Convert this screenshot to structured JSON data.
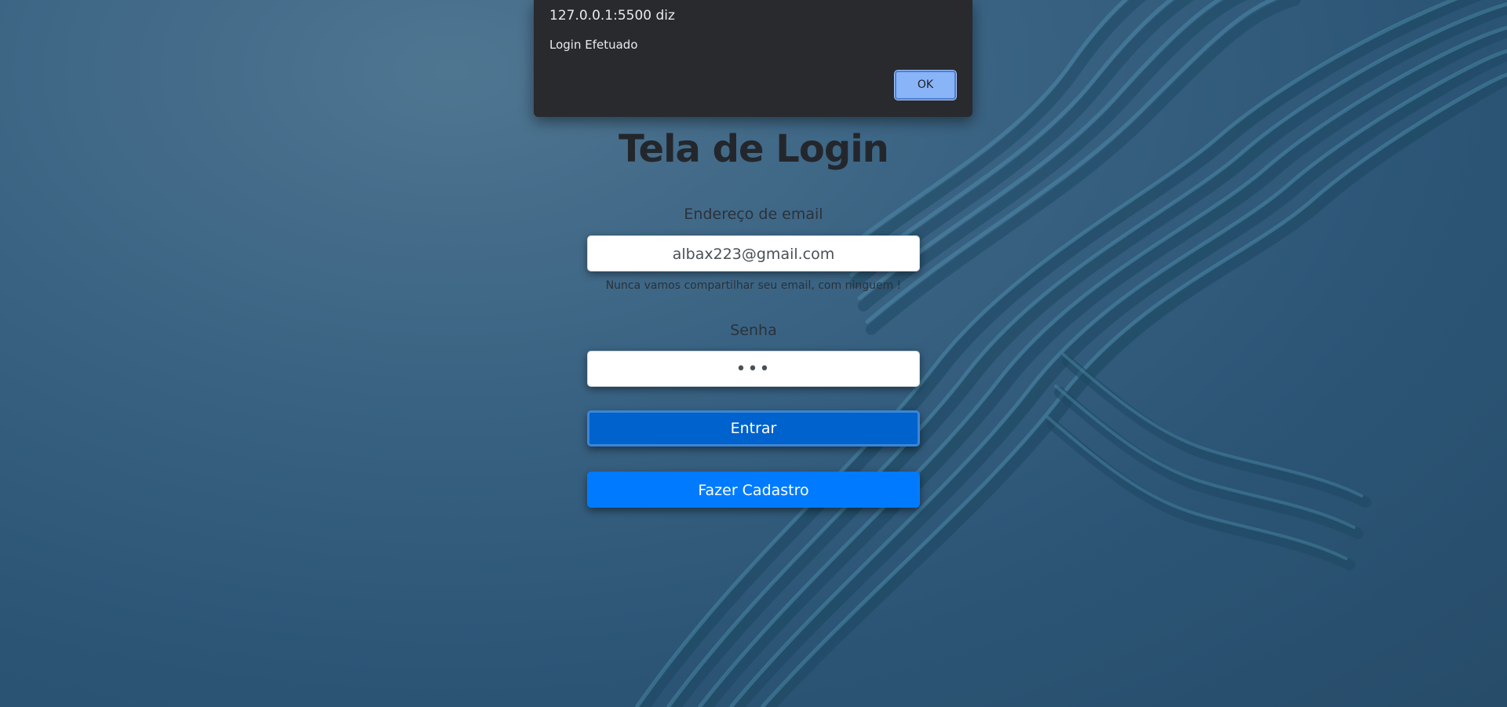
{
  "alert": {
    "origin": "127.0.0.1:5500 diz",
    "message": "Login Efetuado",
    "ok_label": "OK"
  },
  "login": {
    "title": "Tela de Login",
    "email_label": "Endereço de email",
    "email_value": "albax223@gmail.com",
    "email_help": "Nunca vamos compartilhar seu email, com ninguem !",
    "password_label": "Senha",
    "password_value": "•••",
    "enter_label": "Entrar",
    "signup_label": "Fazer Cadastro"
  },
  "colors": {
    "background": "#2c5576",
    "primary": "#007bff",
    "primary_active": "#0062cc",
    "dialog_bg": "#292a2d",
    "dialog_button": "#8ab4f8"
  }
}
